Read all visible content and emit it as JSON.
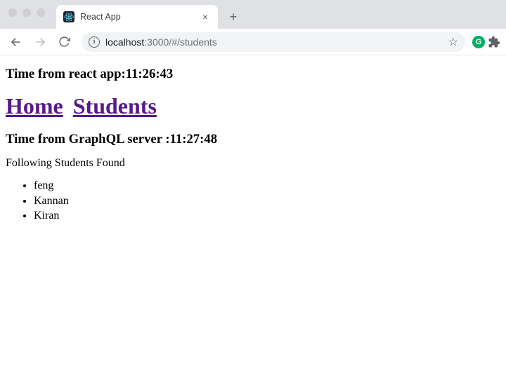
{
  "browser": {
    "tab_title": "React App",
    "url_host": "localhost",
    "url_path": ":3000/#/students"
  },
  "page": {
    "react_time_label": "Time from react app:",
    "react_time_value": "11:26:43",
    "nav": {
      "home": "Home",
      "students": "Students"
    },
    "graphql_time_label": "Time from GraphQL server :",
    "graphql_time_value": "11:27:48",
    "found_text": "Following Students Found",
    "students": [
      "feng",
      "Kannan",
      "Kiran"
    ]
  }
}
